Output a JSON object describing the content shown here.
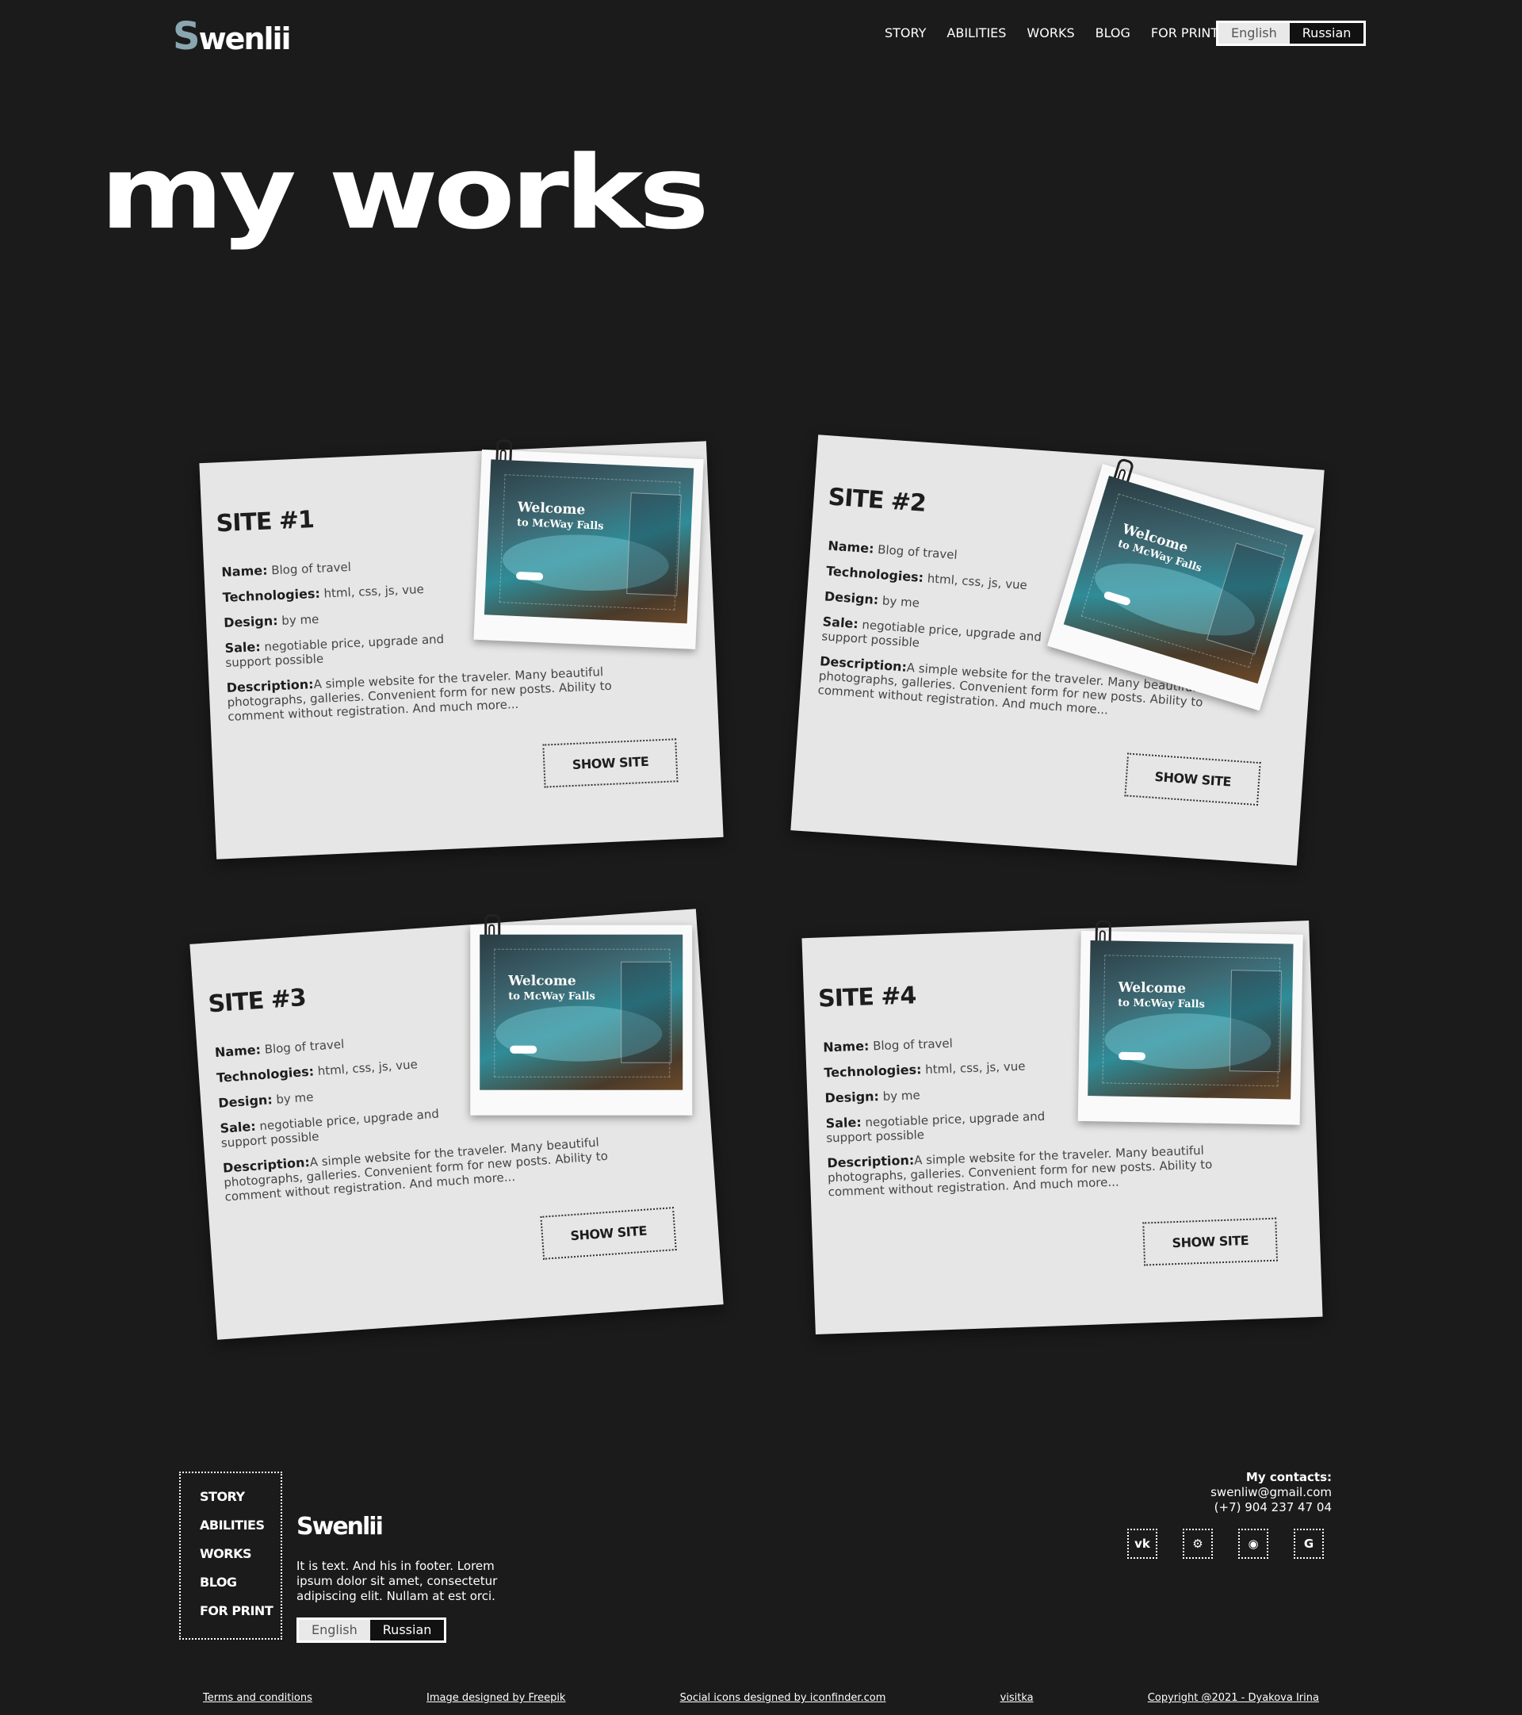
{
  "header": {
    "logo_initial": "S",
    "logo_rest": "wenlii",
    "nav": [
      "STORY",
      "ABILITIES",
      "WORKS",
      "BLOG",
      "FOR PRINT"
    ],
    "lang": {
      "english": "English",
      "russian": "Russian"
    }
  },
  "page_title": "my works",
  "cards": [
    {
      "heading": "SITE #1",
      "name_label": "Name:",
      "name": "Blog of travel",
      "tech_label": "Technologies:",
      "tech": "html, css, js, vue",
      "design_label": "Design:",
      "design": "by me",
      "sale_label": "Sale:",
      "sale": "negotiable price, upgrade and support possible",
      "desc_label": "Description:",
      "desc": "A simple website for the traveler. Many beautiful photographs, galleries. Convenient form for new posts. Ability to comment without registration. And much more...",
      "shot_title": "Welcome",
      "shot_sub": "to McWay Falls",
      "button": "SHOW SITE"
    },
    {
      "heading": "SITE #2",
      "name_label": "Name:",
      "name": "Blog of travel",
      "tech_label": "Technologies:",
      "tech": "html, css, js, vue",
      "design_label": "Design:",
      "design": "by me",
      "sale_label": "Sale:",
      "sale": "negotiable price, upgrade and support possible",
      "desc_label": "Description:",
      "desc": "A simple website for the traveler. Many beautiful photographs, galleries. Convenient form for new posts. Ability to comment without registration. And much more...",
      "shot_title": "Welcome",
      "shot_sub": "to McWay Falls",
      "button": "SHOW SITE"
    },
    {
      "heading": "SITE #3",
      "name_label": "Name:",
      "name": "Blog of travel",
      "tech_label": "Technologies:",
      "tech": "html, css, js, vue",
      "design_label": "Design:",
      "design": "by me",
      "sale_label": "Sale:",
      "sale": "negotiable price, upgrade and support possible",
      "desc_label": "Description:",
      "desc": "A simple website for the traveler. Many beautiful photographs, galleries. Convenient form for new posts. Ability to comment without registration. And much more...",
      "shot_title": "Welcome",
      "shot_sub": "to McWay Falls",
      "button": "SHOW SITE"
    },
    {
      "heading": "SITE #4",
      "name_label": "Name:",
      "name": "Blog of travel",
      "tech_label": "Technologies:",
      "tech": "html, css, js, vue",
      "design_label": "Design:",
      "design": "by me",
      "sale_label": "Sale:",
      "sale": "negotiable price, upgrade and support possible",
      "desc_label": "Description:",
      "desc": "A simple website for the traveler. Many beautiful photographs, galleries. Convenient form for new posts. Ability to comment without registration. And much more...",
      "shot_title": "Welcome",
      "shot_sub": "to McWay Falls",
      "button": "SHOW SITE"
    }
  ],
  "footer": {
    "nav": [
      "STORY",
      "ABILITIES",
      "WORKS",
      "BLOG",
      "FOR PRINT"
    ],
    "logo": "Swenlii",
    "text": "It is text. And his in footer. Lorem ipsum dolor sit amet, consectetur adipiscing elit. Nullam at est orci.",
    "lang": {
      "english": "English",
      "russian": "Russian"
    },
    "contacts_title": "My contacts:",
    "email": "swenliw@gmail.com",
    "phone": "(+7) 904 237 47 04",
    "socials": [
      {
        "icon": "vk-icon",
        "glyph": "vk"
      },
      {
        "icon": "steam-icon",
        "glyph": "⚙"
      },
      {
        "icon": "github-icon",
        "glyph": "◉"
      },
      {
        "icon": "google-icon",
        "glyph": "G"
      }
    ],
    "links": [
      "Terms and conditions",
      "Image designed by Freepik",
      "Social icons designed by iconfinder.com",
      "visitka",
      "Copyright @2021 - Dyakova Irina"
    ]
  },
  "colors": {
    "background": "#1b1b1b",
    "card": "#e6e6e6",
    "logo_accent": "#8aa6b0"
  }
}
